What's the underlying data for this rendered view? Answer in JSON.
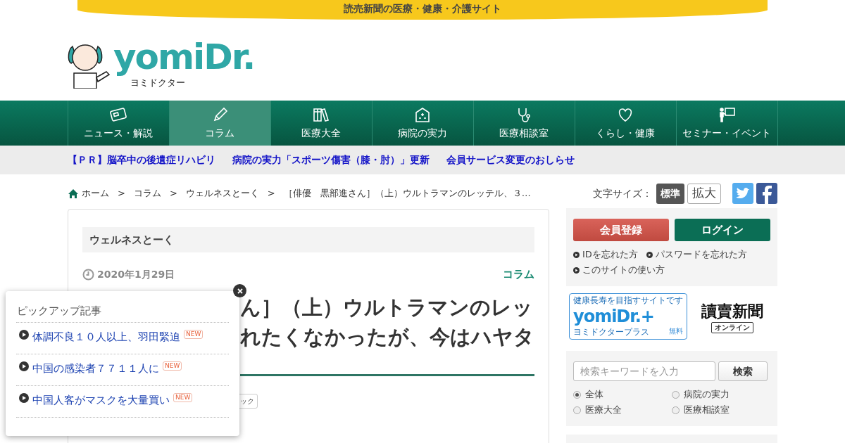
{
  "top_banner": {
    "text": "読売新聞の医療・健康・介護サイト"
  },
  "logo": {
    "wordmark": "yomiDr.",
    "subtitle": "ヨミドクター"
  },
  "nav": [
    {
      "label": "ニュース・解説",
      "selected": false
    },
    {
      "label": "コラム",
      "selected": true
    },
    {
      "label": "医療大全",
      "selected": false
    },
    {
      "label": "病院の実力",
      "selected": false
    },
    {
      "label": "医療相談室",
      "selected": false
    },
    {
      "label": "くらし・健康",
      "selected": false
    },
    {
      "label": "セミナー・イベント",
      "selected": false
    }
  ],
  "notices": [
    "【ＰＲ】脳卒中の後遺症リハビリ",
    "病院の実力「スポーツ傷害（膝・肘）」更新",
    "会員サービス変更のおしらせ"
  ],
  "breadcrumb": [
    "ホーム",
    "コラム",
    "ウェルネスとーく",
    "［俳優　黒部進さん］（上）ウルトラマンのレッテル、３…"
  ],
  "breadcrumb_separator": ">",
  "font_size": {
    "label": "文字サイズ：",
    "options": [
      {
        "label": "標準",
        "selected": true
      },
      {
        "label": "拡大",
        "selected": false
      }
    ]
  },
  "article": {
    "series": "ウェルネスとーく",
    "date": "2020年1月29日",
    "category": "コラム",
    "title_lines": [
      "ん］（上）ウルトラマンのレッ",
      "れたくなかったが、今はハヤタ"
    ],
    "tag": "ック"
  },
  "member": {
    "register": "会員登録",
    "login": "ログイン",
    "links": [
      "IDを忘れた方",
      "パスワードを忘れた方",
      "このサイトの使い方"
    ]
  },
  "banners": {
    "plus": {
      "tagline": "健康長寿を目指すサイトです",
      "wordmark": "yomiDr.+",
      "subtitle": "ヨミドクタープラス",
      "badge": "無料"
    },
    "yomiuri": {
      "wordmark": "讀賣新聞",
      "badge": "オンライン"
    }
  },
  "search": {
    "placeholder": "検索キーワードを入力",
    "button": "検索",
    "scopes": [
      {
        "label": "全体",
        "selected": true
      },
      {
        "label": "病院の実力",
        "selected": false
      },
      {
        "label": "医療大全",
        "selected": false
      },
      {
        "label": "医療相談室",
        "selected": false
      }
    ]
  },
  "pickup": {
    "title": "ピックアップ記事",
    "items": [
      {
        "title": "体調不良１０人以上、羽田緊迫",
        "badge": "NEW"
      },
      {
        "title": "中国の感染者７７１１人に",
        "badge": "NEW"
      },
      {
        "title": "中国人客がマスクを大量買い",
        "badge": "NEW"
      }
    ]
  }
}
